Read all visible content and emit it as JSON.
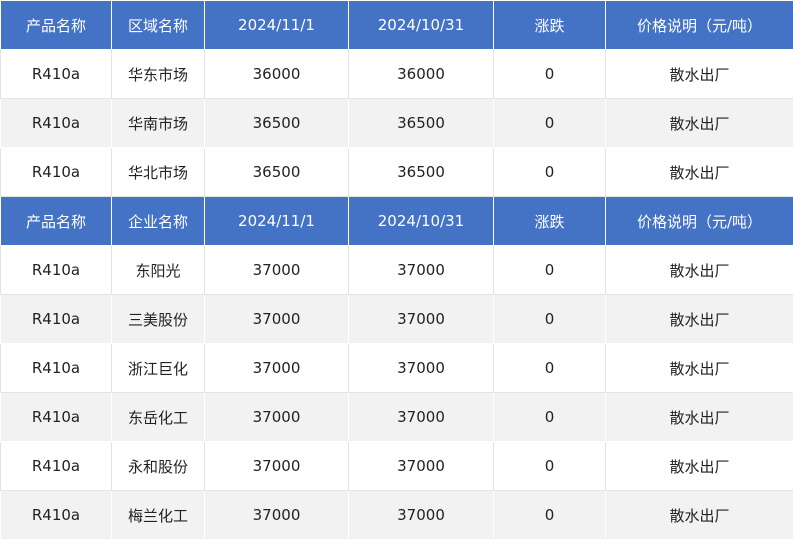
{
  "tables": [
    {
      "headers": [
        "产品名称",
        "区域名称",
        "2024/11/1",
        "2024/10/31",
        "涨跌",
        "价格说明（元/吨）"
      ],
      "rows": [
        [
          "R410a",
          "华东市场",
          "36000",
          "36000",
          "0",
          "散水出厂"
        ],
        [
          "R410a",
          "华南市场",
          "36500",
          "36500",
          "0",
          "散水出厂"
        ],
        [
          "R410a",
          "华北市场",
          "36500",
          "36500",
          "0",
          "散水出厂"
        ]
      ]
    },
    {
      "headers": [
        "产品名称",
        "企业名称",
        "2024/11/1",
        "2024/10/31",
        "涨跌",
        "价格说明（元/吨）"
      ],
      "rows": [
        [
          "R410a",
          "东阳光",
          "37000",
          "37000",
          "0",
          "散水出厂"
        ],
        [
          "R410a",
          "三美股份",
          "37000",
          "37000",
          "0",
          "散水出厂"
        ],
        [
          "R410a",
          "浙江巨化",
          "37000",
          "37000",
          "0",
          "散水出厂"
        ],
        [
          "R410a",
          "东岳化工",
          "37000",
          "37000",
          "0",
          "散水出厂"
        ],
        [
          "R410a",
          "永和股份",
          "37000",
          "37000",
          "0",
          "散水出厂"
        ],
        [
          "R410a",
          "梅兰化工",
          "37000",
          "37000",
          "0",
          "散水出厂"
        ]
      ]
    }
  ],
  "colors": {
    "header_bg": "#4472c4",
    "header_text": "#ffffff",
    "row_alt_bg": "#f2f2f2"
  }
}
